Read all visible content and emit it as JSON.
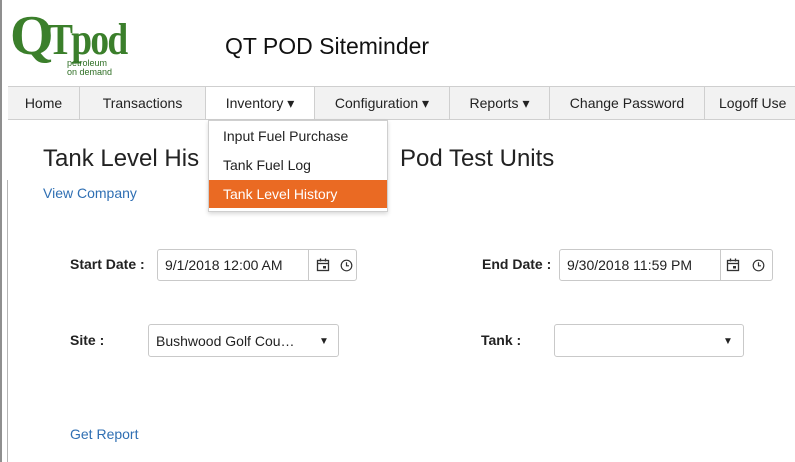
{
  "header": {
    "logo_text_q": "Q",
    "logo_text_pod": "Tpod",
    "logo_tagline_1": "petroleum",
    "logo_tagline_2": "on demand",
    "app_title": "QT POD Siteminder"
  },
  "nav": [
    {
      "label": "Home"
    },
    {
      "label": "Transactions"
    },
    {
      "label": "Inventory ▾"
    },
    {
      "label": "Configuration ▾"
    },
    {
      "label": "Reports ▾"
    },
    {
      "label": "Change Password"
    },
    {
      "label": "Logoff Use"
    }
  ],
  "inventory_menu": {
    "items": [
      "Input Fuel Purchase",
      "Tank Fuel Log",
      "Tank Level History"
    ],
    "selected": "Tank Level History",
    "highlight_color": "#ea6a23"
  },
  "page": {
    "title_left": "Tank Level His",
    "title_right": "Pod Test Units",
    "view_company": "View Company",
    "get_report": "Get Report"
  },
  "form": {
    "start_date_label": "Start Date :",
    "start_date_value": "9/1/2018 12:00 AM",
    "end_date_label": "End Date :",
    "end_date_value": "9/30/2018 11:59 PM",
    "site_label": "Site :",
    "site_value": "Bushwood Golf Cou…",
    "tank_label": "Tank :",
    "tank_value": ""
  },
  "colors": {
    "brand_green": "#3b7f2b",
    "link_blue": "#2f6fb3"
  }
}
